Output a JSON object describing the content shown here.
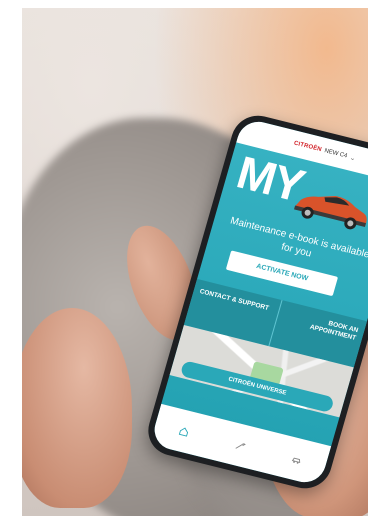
{
  "app": {
    "brand": "CITROËN",
    "selector_label": "NEW C4",
    "hero_title": "MY",
    "message": "Maintenance e-book is available for you",
    "activate_button": "ACTIVATE NOW",
    "panels": [
      {
        "label": "CONTACT & SUPPORT"
      },
      {
        "label": "BOOK AN APPOINTMENT"
      }
    ],
    "universe_label": "CITROËN UNIVERSE",
    "nav": [
      {
        "icon": "home-icon"
      },
      {
        "icon": "tools-icon"
      },
      {
        "icon": "car-icon"
      }
    ],
    "colors": {
      "accent": "#2aa8b8",
      "brand_red": "#d2232a",
      "car_orange": "#d9532a"
    }
  }
}
